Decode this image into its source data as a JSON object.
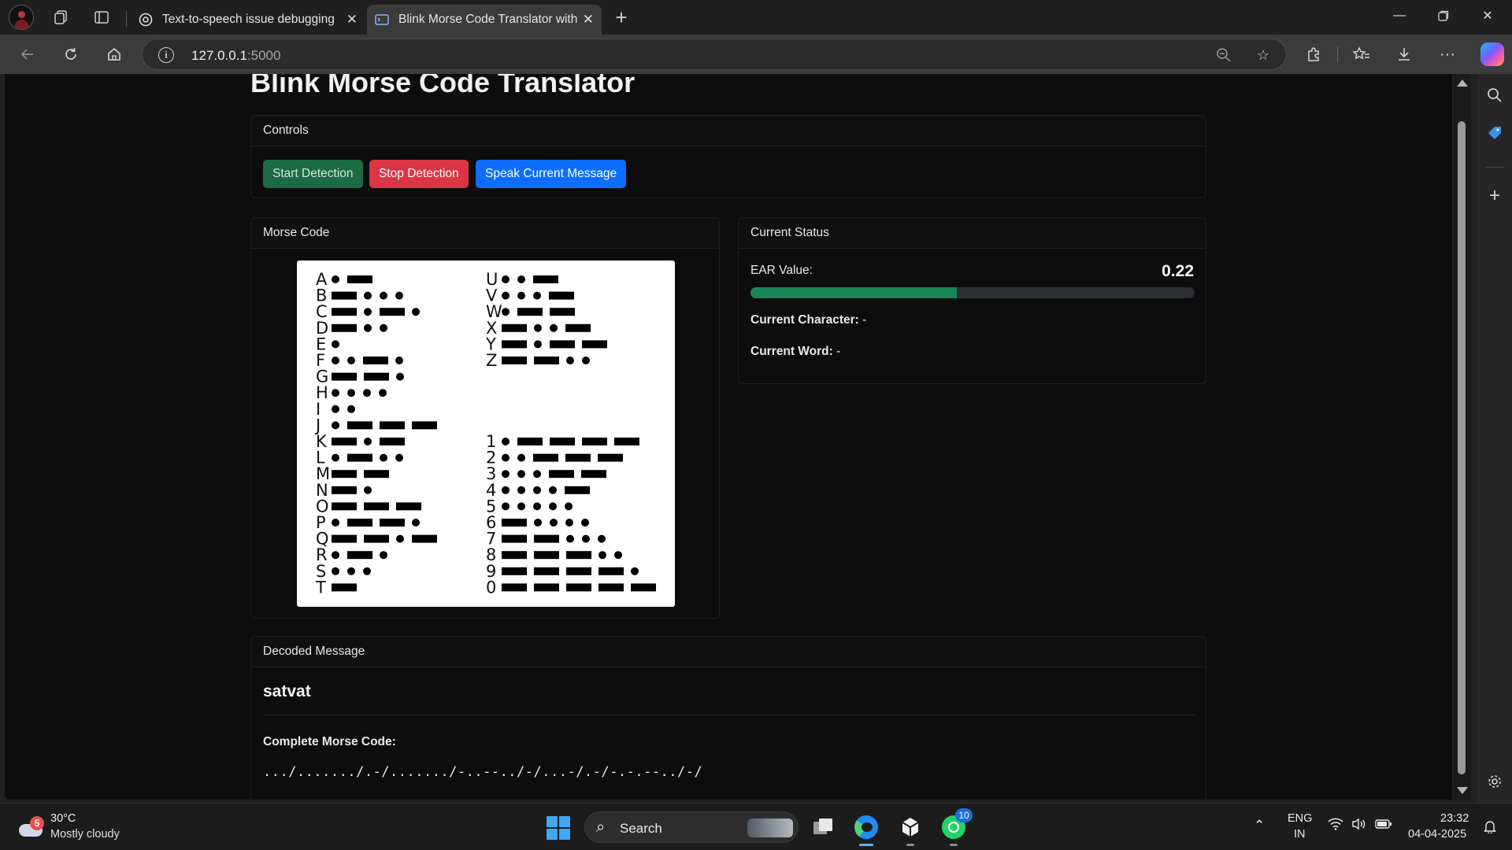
{
  "browser": {
    "tabs": [
      {
        "label": "Text-to-speech issue debugging",
        "icon": "chatgpt-icon"
      },
      {
        "label": "Blink Morse Code Translator with",
        "icon": "terminal-icon",
        "active": true
      }
    ],
    "url": {
      "host": "127.0.0.1",
      "port": ":5000"
    }
  },
  "page": {
    "title": "Blink Morse Code Translator",
    "controls": {
      "header": "Controls",
      "start_label": "Start Detection",
      "stop_label": "Stop Detection",
      "speak_label": "Speak Current Message"
    },
    "morse_card": {
      "header": "Morse Code",
      "chart": {
        "letters": [
          {
            "ch": "A",
            "code": ".-"
          },
          {
            "ch": "B",
            "code": "-..."
          },
          {
            "ch": "C",
            "code": "-.-."
          },
          {
            "ch": "D",
            "code": "-.."
          },
          {
            "ch": "E",
            "code": "."
          },
          {
            "ch": "F",
            "code": "..-."
          },
          {
            "ch": "G",
            "code": "--."
          },
          {
            "ch": "H",
            "code": "...."
          },
          {
            "ch": "I",
            "code": ".."
          },
          {
            "ch": "J",
            "code": ".---"
          },
          {
            "ch": "K",
            "code": "-.-"
          },
          {
            "ch": "L",
            "code": ".-.."
          },
          {
            "ch": "M",
            "code": "--"
          },
          {
            "ch": "N",
            "code": "-."
          },
          {
            "ch": "O",
            "code": "---"
          },
          {
            "ch": "P",
            "code": ".--."
          },
          {
            "ch": "Q",
            "code": "--.-"
          },
          {
            "ch": "R",
            "code": ".-."
          },
          {
            "ch": "S",
            "code": "..."
          },
          {
            "ch": "T",
            "code": "-"
          }
        ],
        "letters2": [
          {
            "ch": "U",
            "code": "..-"
          },
          {
            "ch": "V",
            "code": "...-"
          },
          {
            "ch": "W",
            "code": ".--"
          },
          {
            "ch": "X",
            "code": "-..-"
          },
          {
            "ch": "Y",
            "code": "-.--"
          },
          {
            "ch": "Z",
            "code": "--.."
          }
        ],
        "digits": [
          {
            "ch": "1",
            "code": ".----"
          },
          {
            "ch": "2",
            "code": "..---"
          },
          {
            "ch": "3",
            "code": "...--"
          },
          {
            "ch": "4",
            "code": "....-"
          },
          {
            "ch": "5",
            "code": "....."
          },
          {
            "ch": "6",
            "code": "-...."
          },
          {
            "ch": "7",
            "code": "--..."
          },
          {
            "ch": "8",
            "code": "---.."
          },
          {
            "ch": "9",
            "code": "----."
          },
          {
            "ch": "0",
            "code": "-----"
          }
        ]
      }
    },
    "status": {
      "header": "Current Status",
      "ear_label": "EAR Value:",
      "ear_value": "0.22",
      "ear_fill_fraction": 0.465,
      "char_label": "Current Character:",
      "char_value": "-",
      "word_label": "Current Word:",
      "word_value": "-"
    },
    "decoded": {
      "header": "Decoded Message",
      "message": "satvat",
      "complete_label": "Complete Morse Code:",
      "complete_value": ".../......./.-/......./-..--../-/...-/.-/-.-.--../-/"
    }
  },
  "taskbar": {
    "weather": {
      "badge": "5",
      "temp": "30°C",
      "desc": "Mostly cloudy"
    },
    "search_placeholder": "Search",
    "whatsapp_badge": "10",
    "lang": "ENG",
    "region": "IN",
    "time": "23:32",
    "date": "04-04-2025"
  },
  "colors": {
    "start_btn": "#1b6b45",
    "stop_btn": "#dc3545",
    "speak_btn": "#0d6efd",
    "progress_fill": "#198754"
  }
}
